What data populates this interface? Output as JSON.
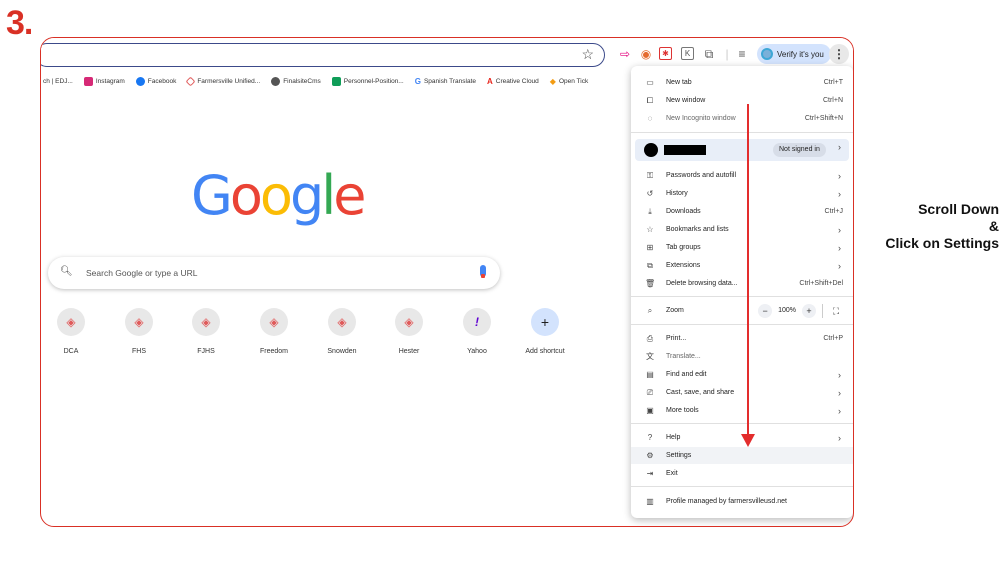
{
  "step": {
    "number": "3."
  },
  "instruction": {
    "line1": "Scroll Down",
    "line2": "&",
    "line3": "Click on Settings"
  },
  "toolbar": {
    "verify_label": "Verify it's you",
    "icons": [
      "star-icon",
      "extension-icons",
      "puzzle-icon",
      "reading-list-icon",
      "kebab-menu-icon"
    ]
  },
  "bookmarks": [
    {
      "label": "ch | EDJ..."
    },
    {
      "label": "Instagram"
    },
    {
      "label": "Facebook"
    },
    {
      "label": "Farmersville Unified..."
    },
    {
      "label": "FinalsiteCms"
    },
    {
      "label": "Personnel-Position..."
    },
    {
      "label": "Spanish Translate"
    },
    {
      "label": "Creative Cloud"
    },
    {
      "label": "Open Tick"
    }
  ],
  "google": {
    "logo_letters": [
      "G",
      "o",
      "o",
      "g",
      "l",
      "e"
    ],
    "logo_colors": [
      "#4285f4",
      "#ea4335",
      "#fbbc05",
      "#4285f4",
      "#34a853",
      "#ea4335"
    ],
    "search_placeholder": "Search Google or type a URL"
  },
  "shortcuts": [
    {
      "label": "DCA"
    },
    {
      "label": "FHS"
    },
    {
      "label": "FJHS"
    },
    {
      "label": "Freedom"
    },
    {
      "label": "Snowden"
    },
    {
      "label": "Hester"
    },
    {
      "label": "Yahoo"
    },
    {
      "label": "Add shortcut"
    }
  ],
  "menu": {
    "new_tab": {
      "label": "New tab",
      "shortcut": "Ctrl+T"
    },
    "new_window": {
      "label": "New window",
      "shortcut": "Ctrl+N"
    },
    "incognito": {
      "label": "New Incognito window",
      "shortcut": "Ctrl+Shift+N"
    },
    "profile_status": "Not signed in",
    "passwords": {
      "label": "Passwords and autofill"
    },
    "history": {
      "label": "History"
    },
    "downloads": {
      "label": "Downloads",
      "shortcut": "Ctrl+J"
    },
    "bookmarks": {
      "label": "Bookmarks and lists"
    },
    "tab_groups": {
      "label": "Tab groups"
    },
    "extensions": {
      "label": "Extensions"
    },
    "delete_data": {
      "label": "Delete browsing data...",
      "shortcut": "Ctrl+Shift+Del"
    },
    "zoom": {
      "label": "Zoom",
      "value": "100%",
      "minus": "−",
      "plus": "+"
    },
    "print": {
      "label": "Print...",
      "shortcut": "Ctrl+P"
    },
    "translate": {
      "label": "Translate..."
    },
    "find_edit": {
      "label": "Find and edit"
    },
    "cast": {
      "label": "Cast, save, and share"
    },
    "more_tools": {
      "label": "More tools"
    },
    "help": {
      "label": "Help"
    },
    "settings": {
      "label": "Settings"
    },
    "exit": {
      "label": "Exit"
    },
    "managed": {
      "label": "Profile managed by farmersvilleusd.net"
    }
  },
  "colors": {
    "accent_red": "#e32d2d",
    "frame_red": "#d93025",
    "verify_bg": "#d3e3fd"
  }
}
